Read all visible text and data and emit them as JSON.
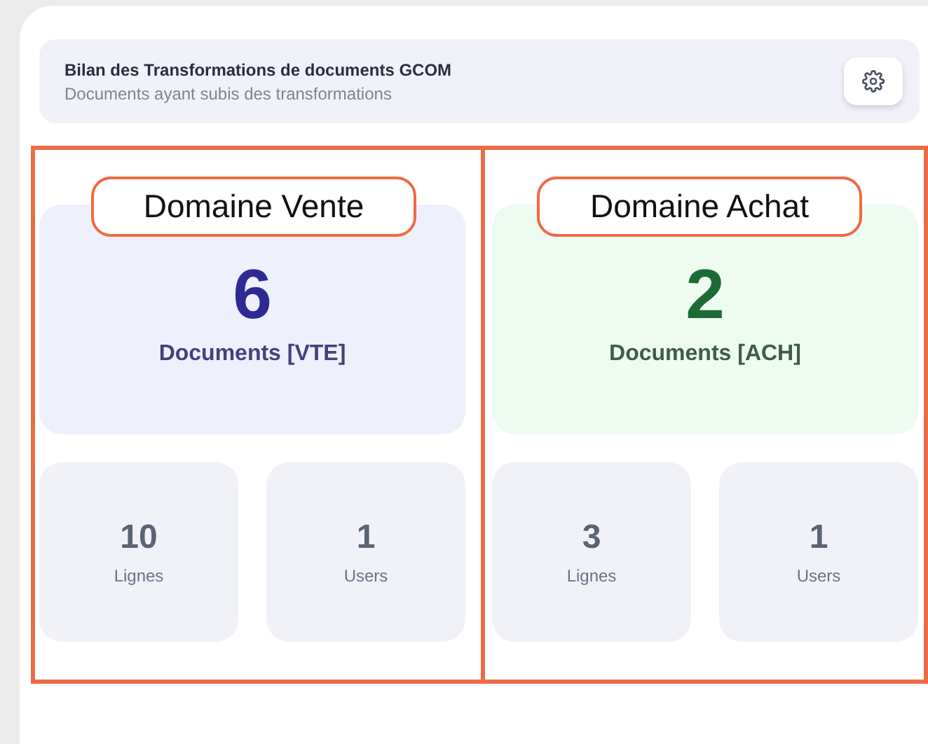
{
  "header": {
    "title": "Bilan des Transformations de documents GCOM",
    "subtitle": "Documents ayant subis des transformations"
  },
  "domains": [
    {
      "label": "Domaine Vente",
      "kind": "sales",
      "color": "#2e2a93",
      "count": "6",
      "caption": "Documents [VTE]",
      "stats": [
        {
          "value": "10",
          "label": "Lignes"
        },
        {
          "value": "1",
          "label": "Users"
        }
      ]
    },
    {
      "label": "Domaine Achat",
      "kind": "purchase",
      "color": "#1d6b34",
      "count": "2",
      "caption": "Documents [ACH]",
      "stats": [
        {
          "value": "3",
          "label": "Lignes"
        },
        {
          "value": "1",
          "label": "Users"
        }
      ]
    }
  ]
}
